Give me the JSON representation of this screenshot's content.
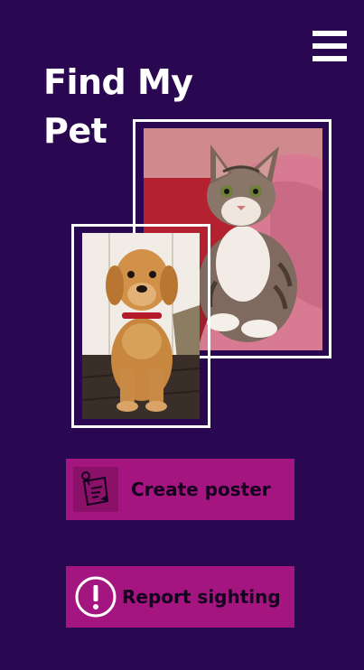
{
  "app": {
    "title_line1": "Find My",
    "title_line2": "Pet"
  },
  "header": {
    "menu_icon": "hamburger-menu-icon"
  },
  "photos": {
    "cat": {
      "subject": "cat-photo"
    },
    "puppy": {
      "subject": "puppy-photo"
    }
  },
  "actions": {
    "create_poster": {
      "label": "Create poster",
      "icon": "poster-note-icon"
    },
    "report_sighting": {
      "label": "Report sighting",
      "icon": "exclamation-circle-icon"
    }
  },
  "colors": {
    "background": "#2a0851",
    "button": "#a51580",
    "button_text": "#14001e",
    "frame": "#ffffff"
  }
}
